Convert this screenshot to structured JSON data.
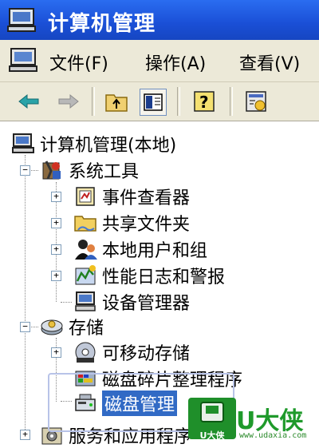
{
  "window": {
    "title": "计算机管理"
  },
  "menu": [
    {
      "label": "文件(F)"
    },
    {
      "label": "操作(A)"
    },
    {
      "label": "查看(V)"
    }
  ],
  "tree": {
    "root": "计算机管理(本地)",
    "system_tools": "系统工具",
    "event_viewer": "事件查看器",
    "shared_folders": "共享文件夹",
    "local_users": "本地用户和组",
    "perf_logs": "性能日志和警报",
    "device_manager": "设备管理器",
    "storage": "存储",
    "removable_storage": "可移动存储",
    "disk_defrag": "磁盘碎片整理程序",
    "disk_management": "磁盘管理",
    "services_apps": "服务和应用程序"
  },
  "watermark": {
    "brand": "U大侠",
    "badge": "U大侠",
    "url": "www.udaxia.com"
  },
  "colors": {
    "title_bar": "#1a4fd6",
    "selection": "#316ac5",
    "chrome": "#ece9d8",
    "watermark": "#1f9a2b"
  }
}
